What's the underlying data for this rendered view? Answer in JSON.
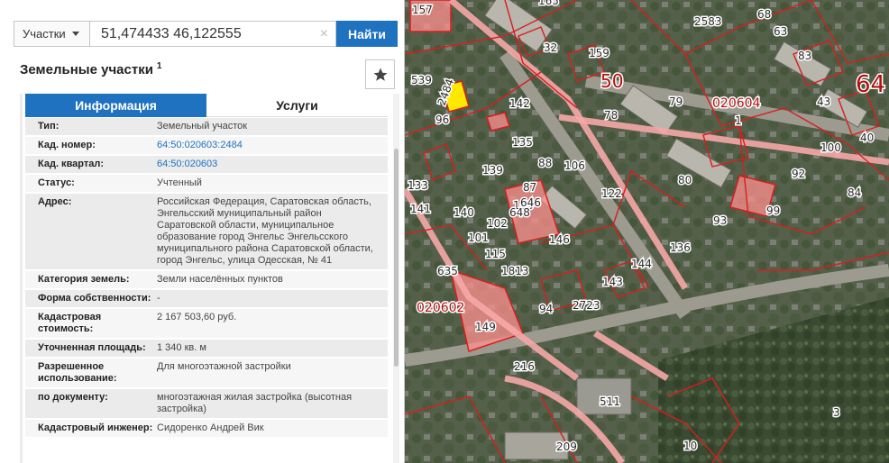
{
  "search": {
    "type_label": "Участки",
    "query": "51,474433 46,122555",
    "clear_glyph": "×",
    "button_label": "Найти"
  },
  "panel": {
    "title": "Земельные участки",
    "title_sup": "1",
    "tabs": [
      "Информация",
      "Услуги"
    ],
    "rows": [
      {
        "label": "Тип:",
        "value": "Земельный участок",
        "link": false
      },
      {
        "label": "Кад. номер:",
        "value": "64:50:020603:2484",
        "link": true
      },
      {
        "label": "Кад. квартал:",
        "value": "64:50:020603",
        "link": true
      },
      {
        "label": "Статус:",
        "value": "Учтенный",
        "link": false
      },
      {
        "label": "Адрес:",
        "value": "Российская Федерация, Саратовская область, Энгельсский муниципальный район Саратовской области, муниципальное образование город Энгельс Энгельсского муниципального района Саратовской области, город Энгельс, улица Одесская, № 41",
        "link": false
      },
      {
        "label": "Категория земель:",
        "value": "Земли населённых пунктов",
        "link": false
      },
      {
        "label": "Форма собственности:",
        "value": "-",
        "link": false
      },
      {
        "label": "Кадастровая стоимость:",
        "value": "2 167 503,60 руб.",
        "link": false
      },
      {
        "label": "Уточненная площадь:",
        "value": "1 340 кв. м",
        "link": false
      },
      {
        "label": "Разрешенное использование:",
        "value": "Для многоэтажной застройки",
        "link": false
      },
      {
        "label": "по документу:",
        "value": "многоэтажная жилая застройка (высотная застройка)",
        "link": false
      },
      {
        "label": "Кадастровый инженер:",
        "value": "Сидоренко Андрей Вик",
        "link": false
      }
    ]
  },
  "map": {
    "colors": {
      "parcel_line": "#d81e1e",
      "parcel_fill": "#ff9a9a",
      "selected_fill": "#ffe800",
      "road": "#f6b3b3"
    },
    "labels": [
      "157",
      "165",
      "2583",
      "68",
      "63",
      "32",
      "159",
      "83",
      "539",
      "50",
      "64",
      "2484",
      "142",
      "79",
      "020604",
      "43",
      "96",
      "78",
      "1",
      "40",
      "100",
      "135",
      "139",
      "88",
      "106",
      "133",
      "80",
      "92",
      "141",
      "140",
      "84",
      "87",
      "103",
      "122",
      "99",
      "101",
      "102",
      "648",
      "646",
      "136",
      "115",
      "146",
      "93",
      "635",
      "1813",
      "144",
      "143",
      "020602",
      "94",
      "2723",
      "149",
      "216",
      "511",
      "3",
      "209",
      "10"
    ]
  }
}
